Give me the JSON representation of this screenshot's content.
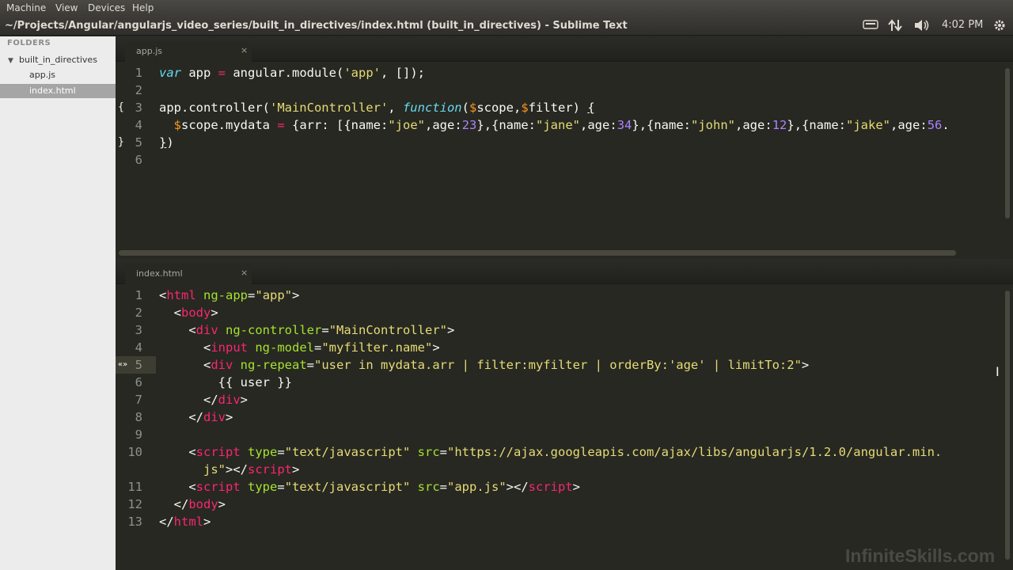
{
  "menubar": {
    "items": [
      "Machine",
      "View",
      "Devices",
      "Help"
    ]
  },
  "window": {
    "title": "~/Projects/Angular/angularjs_video_series/built_in_directives/index.html (built_in_directives) - Sublime Text",
    "clock": "4:02 PM"
  },
  "sidebar": {
    "header": "FOLDERS",
    "folder": "built_in_directives",
    "files": [
      {
        "label": "app.js",
        "selected": false
      },
      {
        "label": "index.html",
        "selected": true
      }
    ]
  },
  "editor_top": {
    "tab_label": "app.js",
    "tab_close": "×",
    "line_numbers": [
      "1",
      "2",
      "3",
      "4",
      "5",
      "6"
    ]
  },
  "editor_bottom": {
    "tab_label": "index.html",
    "tab_close": "×",
    "line_numbers": [
      "1",
      "2",
      "3",
      "4",
      "5",
      "6",
      "7",
      "8",
      "9",
      "10",
      "",
      "11",
      "12",
      "13"
    ]
  },
  "watermark": "InfiniteSkills.com",
  "colors": {
    "editor_bg": "#272822",
    "keyword": "#66d9ef",
    "string": "#e6db74",
    "tag": "#f92672",
    "attribute": "#a6e22e",
    "number": "#ae81ff"
  }
}
